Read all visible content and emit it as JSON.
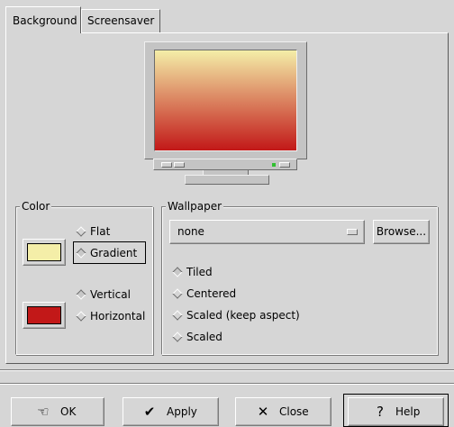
{
  "tabs": [
    {
      "label": "Background",
      "active": true
    },
    {
      "label": "Screensaver",
      "active": false
    }
  ],
  "preview": {
    "gradient_top": "#f4eea8",
    "gradient_bottom": "#c21818"
  },
  "color_group": {
    "title": "Color",
    "primary_color": "#f4eea8",
    "secondary_color": "#c21818",
    "type_options": [
      {
        "label": "Flat",
        "selected": false
      },
      {
        "label": "Gradient",
        "selected": true
      }
    ],
    "direction_options": [
      {
        "label": "Vertical",
        "selected": true
      },
      {
        "label": "Horizontal",
        "selected": false
      }
    ]
  },
  "wallpaper_group": {
    "title": "Wallpaper",
    "selected": "none",
    "browse_label": "Browse...",
    "layout_options": [
      {
        "label": "Tiled",
        "selected": true
      },
      {
        "label": "Centered",
        "selected": false
      },
      {
        "label": "Scaled (keep aspect)",
        "selected": false
      },
      {
        "label": "Scaled",
        "selected": false
      }
    ]
  },
  "buttons": {
    "ok": "OK",
    "apply": "Apply",
    "close": "Close",
    "help": "Help"
  }
}
